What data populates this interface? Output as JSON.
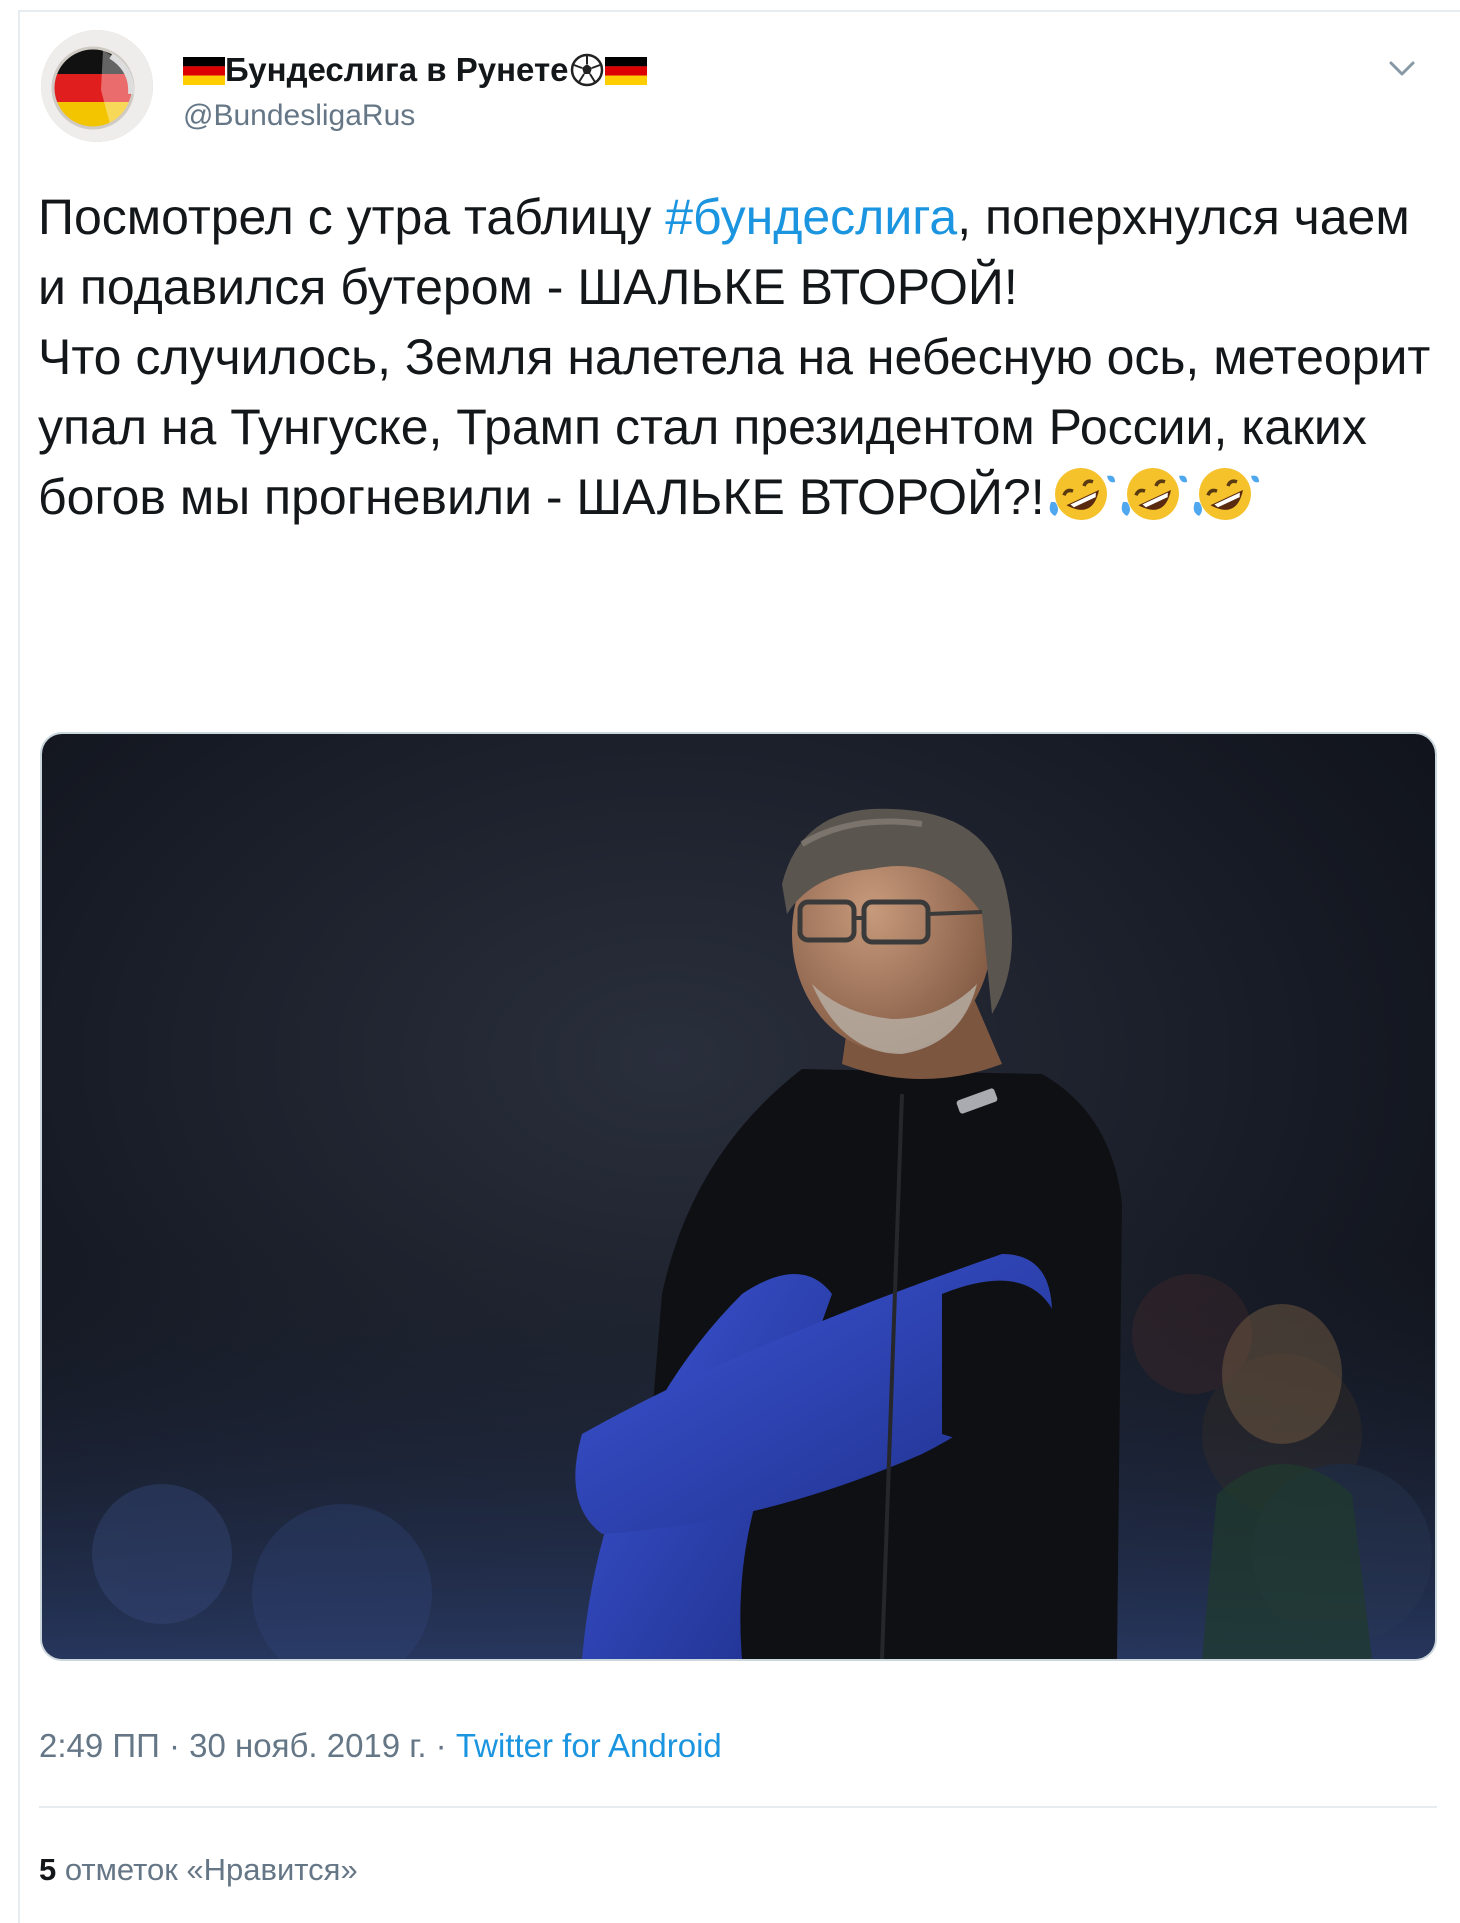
{
  "tweet": {
    "author": {
      "name": "Бундеслига в Рунете",
      "name_emoji_prefix": "flag-germany-icon",
      "name_emoji_suffix": [
        "soccer-ball-icon",
        "flag-germany-icon"
      ],
      "handle": "@BundesligaRus",
      "avatar": "avatar-germany-flag-ball"
    },
    "menu_icon": "chevron-down-icon",
    "text": {
      "paragraph1_before_hashtag": "Посмотрел с утра таблицу ",
      "hashtag": "#бундеслига",
      "paragraph1_after_hashtag": ", поперхнулся чаем и подавился бутером - ШАЛЬКЕ ВТОРОЙ!",
      "paragraph2": "Что случилось, Земля налетела на небесную ось, метеорит упал на Тунгуске, Трамп стал президентом России, каких богов мы прогневили - ШАЛЬКЕ ВТОРОЙ?!",
      "trailing_emoji": [
        "rolling-laughing-icon",
        "rolling-laughing-icon",
        "rolling-laughing-icon"
      ]
    },
    "media": {
      "description_icon": "photo-coach-arms-crossed"
    },
    "meta": {
      "time": "2:49 ПП",
      "separator": " · ",
      "date": "30 нояб. 2019 г.",
      "source": "Twitter for Android"
    },
    "likes": {
      "count": "5",
      "label": " отметок «Нравится»"
    }
  },
  "colors": {
    "link": "#1b95e0",
    "secondary_text": "#657786",
    "primary_text": "#14171a",
    "border": "#e6ecf0"
  }
}
